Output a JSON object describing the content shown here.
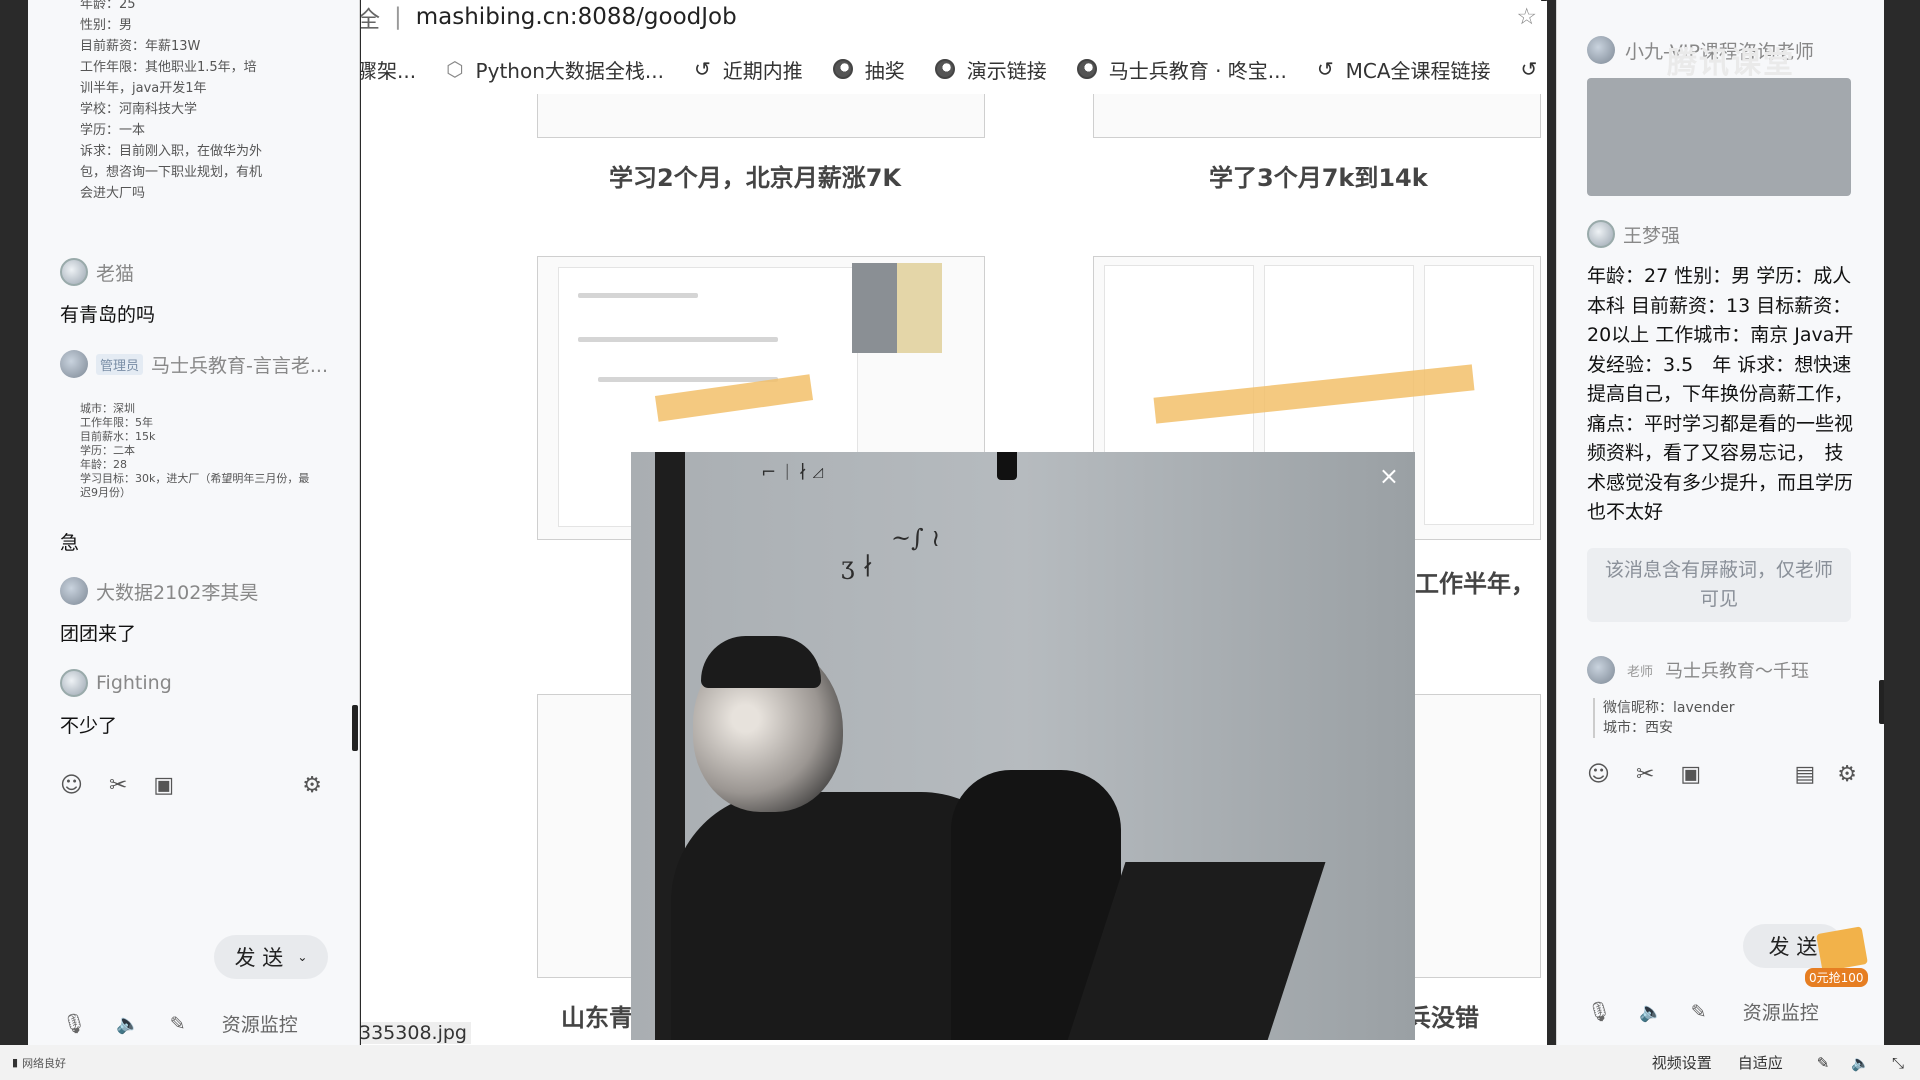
{
  "left_chat": {
    "top_card_lines": [
      "年龄：25",
      "性别：男",
      "目前薪资：年薪13W",
      "工作年限：其他职业1.5年，培",
      "训半年，java开发1年",
      "学校：河南科技大学",
      "学历：一本",
      "诉求：目前刚入职，在做华为外",
      "包，想咨询一下职业规划，有机",
      "会进大厂吗"
    ],
    "messages": [
      {
        "user": "老猫",
        "text": "有青岛的吗"
      },
      {
        "role": "管理员",
        "user": "马士兵教育-言言老...",
        "card_lines": [
          "城市：深圳",
          "工作年限：5年",
          "目前薪水：15k",
          "学历：二本",
          "年龄：28",
          "学习目标：30k，进大厂（希望明年三月份，最",
          "迟9月份）"
        ]
      },
      {
        "text": "急"
      },
      {
        "user": "大数据2102李其昊",
        "text": "团团来了"
      },
      {
        "user": "Fighting",
        "text": "不少了"
      }
    ],
    "send_label": "发 送",
    "bottom_label": "资源监控",
    "toolbar_icons": [
      "smile-icon",
      "scissors-icon",
      "image-icon",
      "settings-icon"
    ]
  },
  "browser": {
    "url": "mashibing.cn:8088/goodJob",
    "tab_prefix": "全",
    "bookmarks": [
      "骤架...",
      "Python大数据全栈...",
      "近期内推",
      "抽奖",
      "演示链接",
      "马士兵教育 · 咚宝...",
      "MCA全课程链接"
    ],
    "captions": [
      "学习2个月，北京月薪涨7K",
      "学了3个月7k到14k",
      "工作半年，",
      "山东青",
      "兵没错"
    ],
    "file_label": "335308.jpg"
  },
  "video": {
    "close": "×"
  },
  "right_chat": {
    "header_text": "小九-VIP课程咨询老师",
    "watermark": "腾讯课堂",
    "user": "王梦强",
    "message": "年龄：27 性别：男 学历：成人本科 目前薪资：13 目标薪资：20以上 工作城市：南京 Java开发经验：3.5　年 诉求：想快速提高自己，下年换份高薪工作，　痛点：平时学习都是看的一些视频资料，看了又容易忘记，　技术感觉没有多少提升，而且学历也不太好",
    "masked": "该消息含有屏蔽词，仅老师可见",
    "teacher_role": "老师",
    "teacher_user": "马士兵教育～千珏",
    "teacher_lines": [
      "微信昵称：lavender",
      "城市：西安"
    ],
    "send_label": "发 送",
    "bottom_label": "资源监控",
    "badge": "0元抢100"
  },
  "status_bar": {
    "left": "网络良好",
    "video_settings": "视频设置",
    "adapt": "自适应"
  }
}
